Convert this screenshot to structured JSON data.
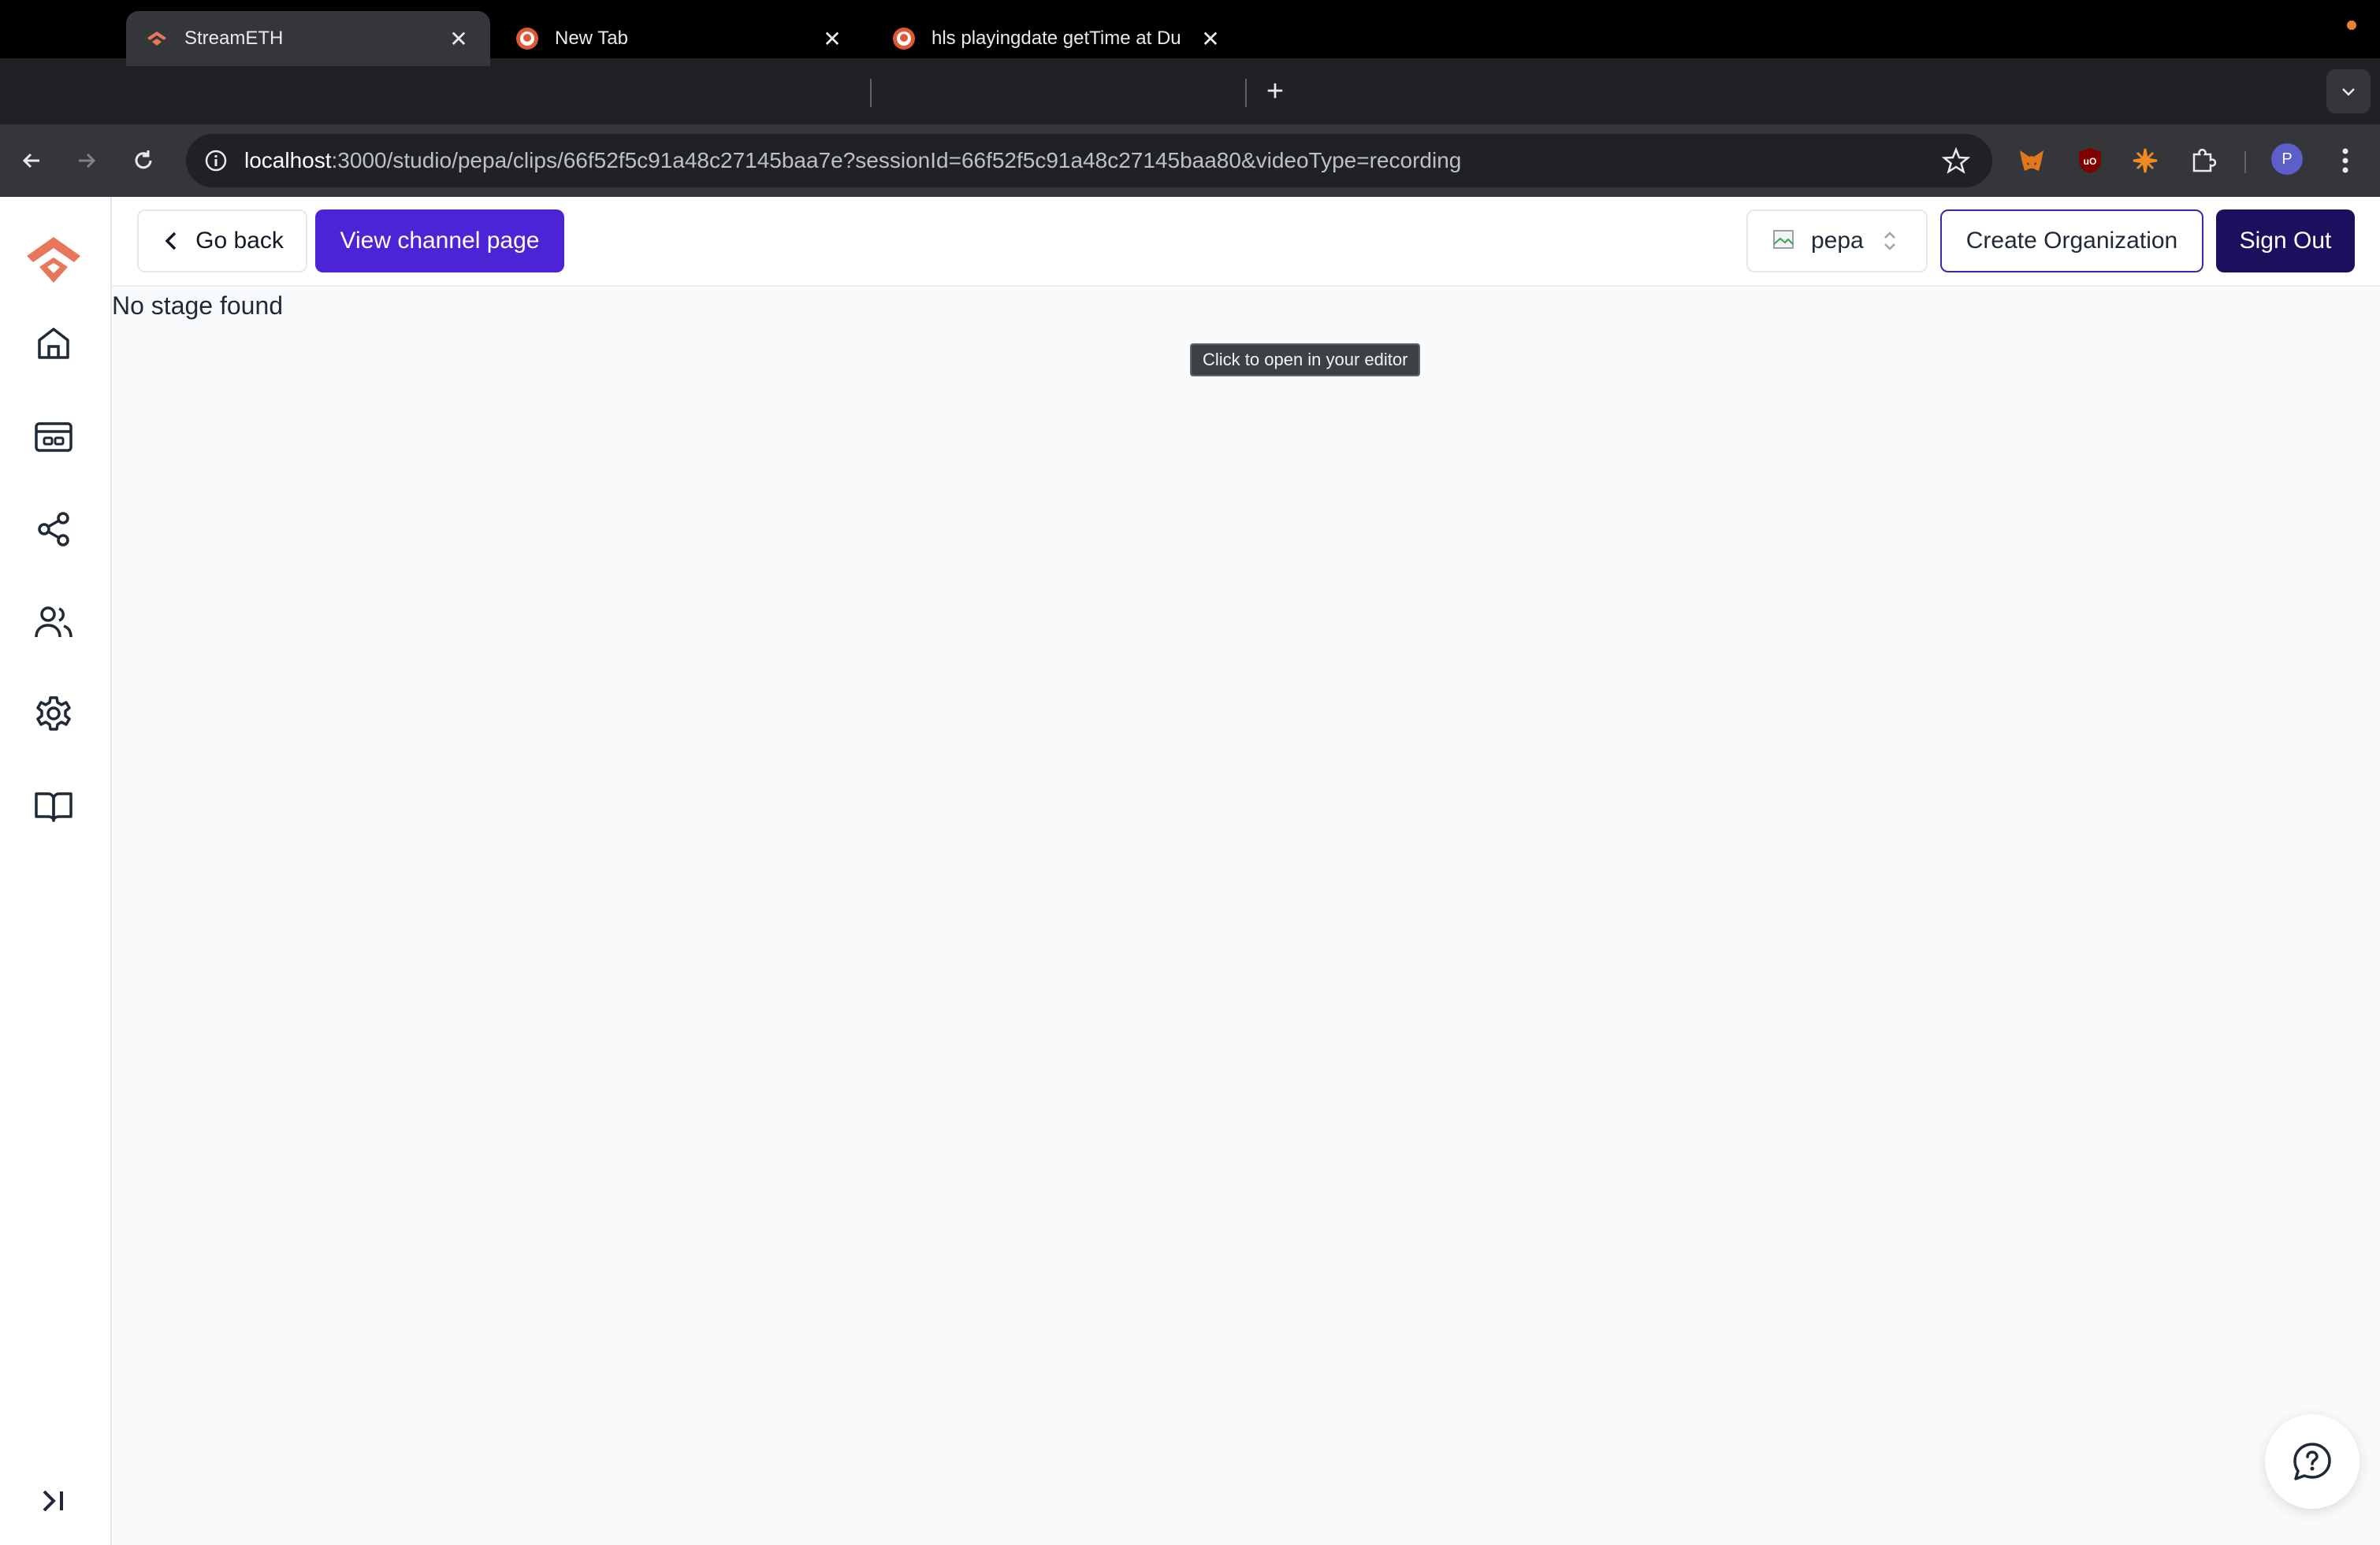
{
  "browser": {
    "tabs": [
      {
        "title": "StreamETH",
        "active": true
      },
      {
        "title": "New Tab",
        "active": false
      },
      {
        "title": "hls playingdate getTime at Du",
        "active": false
      }
    ],
    "url": {
      "host": "localhost",
      "path": ":3000/studio/pepa/clips/66f52f5c91a48c27145baa7e?sessionId=66f52f5c91a48c27145baa80&videoType=recording"
    },
    "profile_initial": "P"
  },
  "header": {
    "go_back_label": "Go back",
    "view_channel_label": "View channel page",
    "org_name": "pepa",
    "create_org_label": "Create Organization",
    "sign_out_label": "Sign Out"
  },
  "main": {
    "message": "No stage found"
  },
  "tooltip": {
    "text": "Click to open in your editor"
  },
  "colors": {
    "brand_primary": "#4c24d6",
    "brand_dark": "#1e0f5e",
    "logo": "#e8765a"
  }
}
